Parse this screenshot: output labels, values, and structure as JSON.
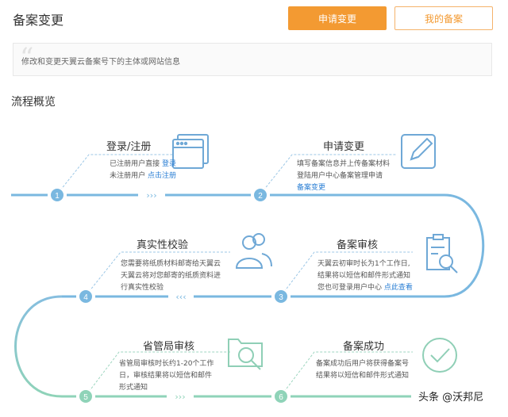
{
  "header": {
    "title": "备案变更",
    "apply_button": "申请变更",
    "my_button": "我的备案"
  },
  "description": {
    "text": "修改和变更天翼云备案号下的主体或网站信息"
  },
  "overview": {
    "title": "流程概览"
  },
  "steps": [
    {
      "number": "1",
      "title": "登录/注册",
      "line1_text": "已注册用户直接",
      "line1_link": "登录",
      "line2_text": "未注册用户",
      "line2_link": "点击注册",
      "icon": "browser-window-icon"
    },
    {
      "number": "2",
      "title": "申请变更",
      "line1": "填写备案信息并上传备案材料",
      "line2": "登陆用户中心备案管理申请",
      "line3_link": "备案变更",
      "icon": "edit-icon"
    },
    {
      "number": "3",
      "title": "备案审核",
      "line1": "天翼云初审时长为1个工作日,",
      "line2": "结果将以短信和邮件形式通知",
      "line3_text": "您也可登录用户中心",
      "line3_link": "点此查看",
      "icon": "document-search-icon"
    },
    {
      "number": "4",
      "title": "真实性校验",
      "line1": "您需要将纸质材料邮寄给天翼云",
      "line2": "天翼云将对您邮寄的纸质资料进",
      "line3": "行真实性校验",
      "icon": "users-icon"
    },
    {
      "number": "5",
      "title": "省管局审核",
      "line1": "省管局审核时长约1-20个工作",
      "line2": "日，审核结果将以短信和邮件",
      "line3": "形式通知",
      "icon": "folder-search-icon"
    },
    {
      "number": "6",
      "title": "备案成功",
      "line1": "备案成功后用户将获得备案号",
      "line2": "结果将以短信和邮件形式通知",
      "icon": "check-circle-icon"
    }
  ],
  "arrows": {
    "right": "›››",
    "left": "‹‹‹"
  },
  "watermark": "头条 @沃邦尼",
  "colors": {
    "accent_orange": "#f39a32",
    "flow_blue": "#7ab8e0",
    "flow_green": "#8fd3b8",
    "link_blue": "#2b7fd4"
  }
}
